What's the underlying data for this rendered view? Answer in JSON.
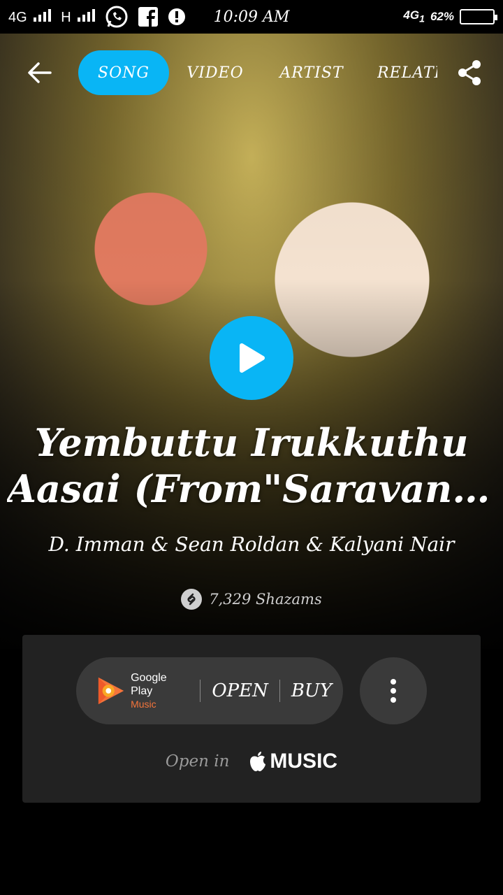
{
  "status_bar": {
    "network1": "4G",
    "network2": "H",
    "time": "10:09 AM",
    "network3": "4G",
    "network3_sub": "1",
    "battery": "62%"
  },
  "nav": {
    "tabs": [
      {
        "label": "SONG",
        "active": true
      },
      {
        "label": "VIDEO",
        "active": false
      },
      {
        "label": "ARTIST",
        "active": false
      },
      {
        "label": "RELATED",
        "active": false
      }
    ]
  },
  "song": {
    "title_line1": "Yembuttu Irukkuthu",
    "title_line2": "Aasai (From\"Saravana...",
    "artists": "D. Imman & Sean Roldan & Kalyani Nair",
    "shazams": "7,329 Shazams"
  },
  "store": {
    "google_play_name": "Google Play",
    "google_play_sub": "Music",
    "open_label": "OPEN",
    "buy_label": "BUY",
    "open_in_label": "Open in",
    "apple_music_label": "MUSIC"
  },
  "colors": {
    "accent": "#09b5f5",
    "card": "#222222",
    "pill": "#3a3a3a",
    "google_play_sub": "#f4743b"
  }
}
